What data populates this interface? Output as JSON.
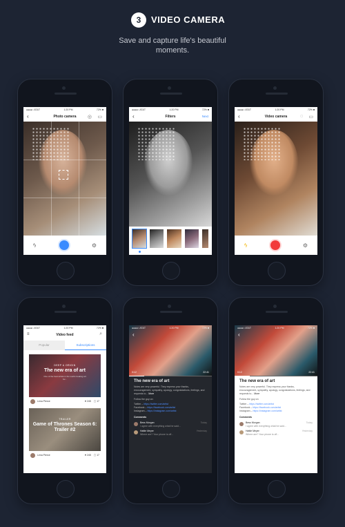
{
  "header": {
    "step": "3",
    "title": "VIDEO CAMERA"
  },
  "subtitle": {
    "line1": "Save and capture life's beautiful",
    "line2": "moments."
  },
  "status": {
    "carrier": "●●●●○ AT&T",
    "time": "1:20 PM",
    "battery": "72% ■"
  },
  "screen1": {
    "title": "Photo camera"
  },
  "screen2": {
    "title": "Filters",
    "next": "Next"
  },
  "screen3": {
    "title": "Video camera"
  },
  "screen4": {
    "title": "Video feed",
    "tabs": [
      "Popular",
      "Subscriptions"
    ],
    "cards": [
      {
        "tag": "DEEP & ORIGIN",
        "title": "The new era of art",
        "desc": "One of the best artists in the world creating art for...",
        "author": "Lena Pierce",
        "likes": "♥ 245",
        "comments": "▢ 17"
      },
      {
        "tag": "TRAILER",
        "title": "Game of Thrones Season 6: Trailer #2",
        "author": "Lena Pierce",
        "likes": "♥ 245",
        "comments": "▢ 17"
      }
    ]
  },
  "article": {
    "elapsed": "0:12",
    "total": "22:41",
    "title": "The new era of art",
    "body": "Notes are very powerful. They express your thanks, encouragement, sympathy, apology, congratulations, feelings, and requests to...",
    "more": "More",
    "follow": "Follow the guy on:",
    "links": [
      {
        "label": "Twitter",
        "url": "https://twitter.com/artist"
      },
      {
        "label": "Facebook",
        "url": "https://facebook.com/artist"
      },
      {
        "label": "Instagram",
        "url": "https://instagram.com/artist"
      }
    ],
    "comments_label": "Comments",
    "comments": [
      {
        "name": "Bess Morgan",
        "text": "I agree with everything what he said...",
        "time": "Today"
      },
      {
        "name": "Hattie Meyer",
        "text": "Where are? Your phone is off...",
        "time": "Yesterday"
      }
    ]
  }
}
